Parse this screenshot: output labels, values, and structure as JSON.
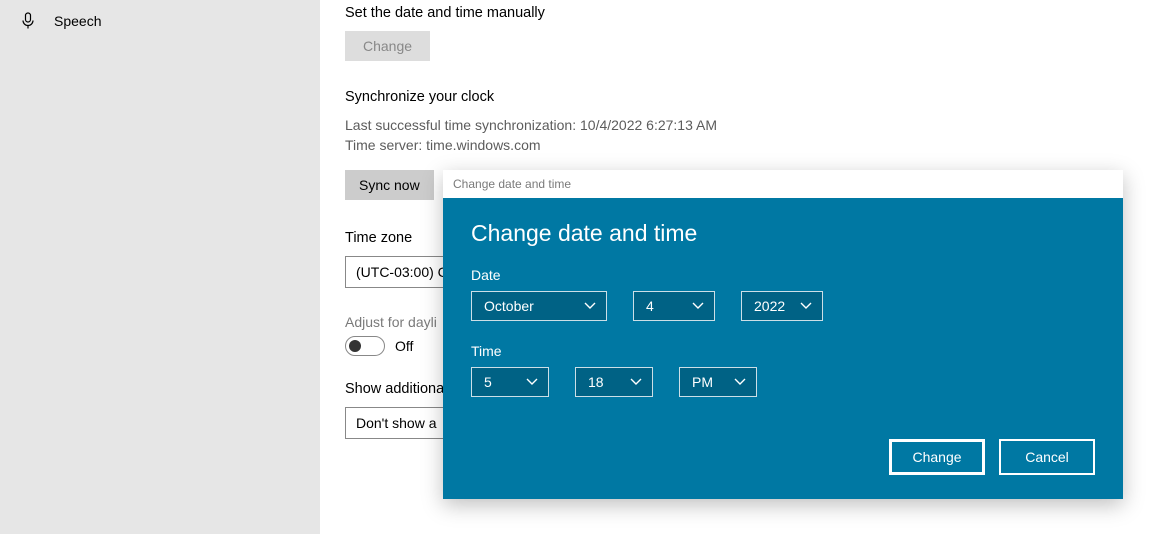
{
  "sidebar": {
    "items": [
      {
        "label": "Speech",
        "icon": "microphone-icon"
      }
    ]
  },
  "manual": {
    "title": "Set the date and time manually",
    "button": "Change"
  },
  "sync": {
    "title": "Synchronize your clock",
    "last_sync_line": "Last successful time synchronization: 10/4/2022 6:27:13 AM",
    "server_line": "Time server: time.windows.com",
    "button": "Sync now"
  },
  "timezone": {
    "title": "Time zone",
    "value": "(UTC-03:00) C"
  },
  "dst": {
    "label": "Adjust for dayli",
    "state": "Off"
  },
  "additional": {
    "label": "Show additiona",
    "value": "Don't show a"
  },
  "dialog": {
    "titlebar": "Change date and time",
    "header": "Change date and time",
    "date_label": "Date",
    "month": "October",
    "day": "4",
    "year": "2022",
    "time_label": "Time",
    "hour": "5",
    "minute": "18",
    "ampm": "PM",
    "change": "Change",
    "cancel": "Cancel"
  }
}
